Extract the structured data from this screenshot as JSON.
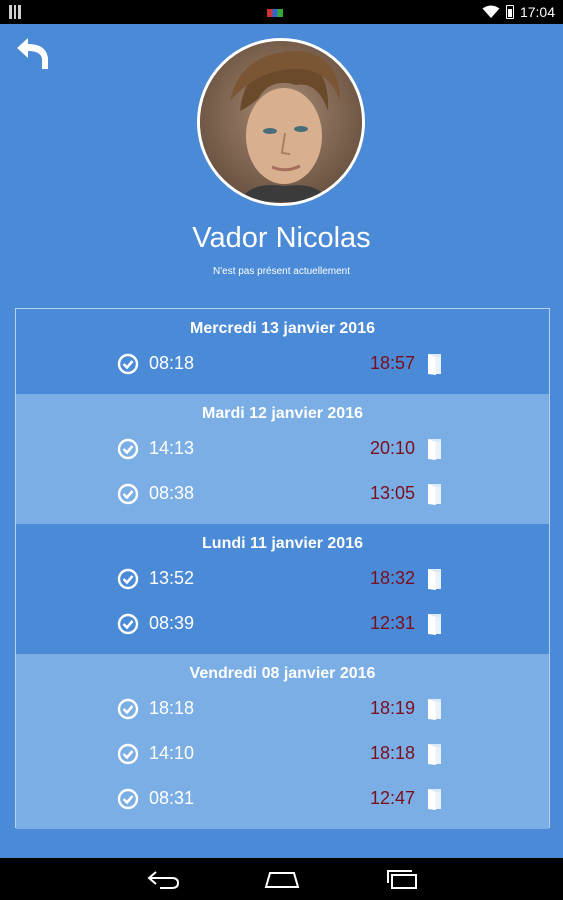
{
  "status_bar": {
    "time": "17:04"
  },
  "profile": {
    "name": "Vador Nicolas",
    "presence": "N'est pas présent actuellement"
  },
  "history": [
    {
      "date": "Mercredi 13 janvier 2016",
      "entries": [
        {
          "in": "08:18",
          "out": "18:57"
        }
      ]
    },
    {
      "date": "Mardi 12 janvier 2016",
      "entries": [
        {
          "in": "14:13",
          "out": "20:10"
        },
        {
          "in": "08:38",
          "out": "13:05"
        }
      ]
    },
    {
      "date": "Lundi 11 janvier 2016",
      "entries": [
        {
          "in": "13:52",
          "out": "18:32"
        },
        {
          "in": "08:39",
          "out": "12:31"
        }
      ]
    },
    {
      "date": "Vendredi 08 janvier 2016",
      "entries": [
        {
          "in": "18:18",
          "out": "18:19"
        },
        {
          "in": "14:10",
          "out": "18:18"
        },
        {
          "in": "08:31",
          "out": "12:47"
        }
      ]
    }
  ],
  "colors": {
    "background": "#4a8ad6",
    "alt_row": "#7aaee4",
    "time_out": "#7a0f1e"
  },
  "icons": {
    "back": "back-arrow-icon",
    "entry_in": "check-circle-icon",
    "entry_out": "door-icon"
  }
}
